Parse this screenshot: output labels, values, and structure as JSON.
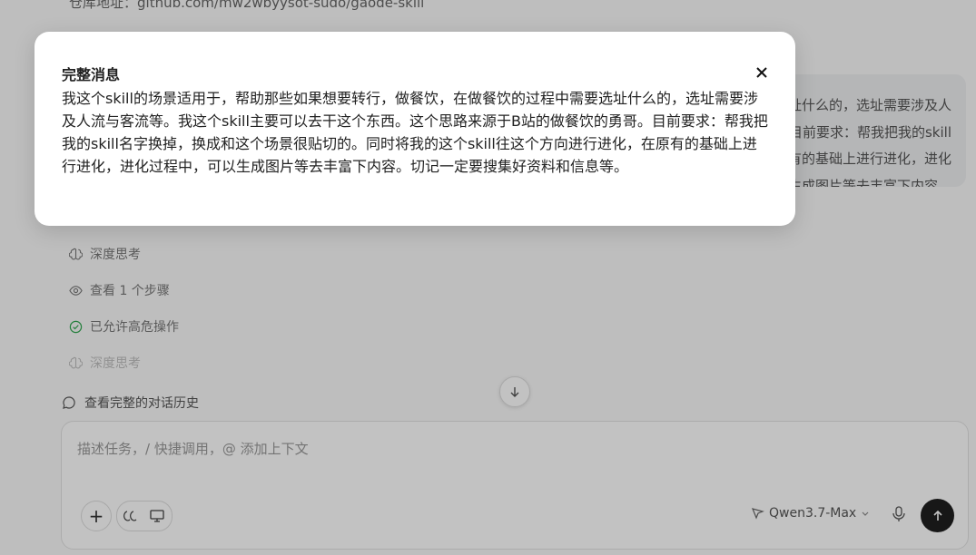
{
  "background": {
    "repo_line": "仓库地址：github.com/mw2wbyysot-sudo/gaode-skill",
    "user_message": "我这个skill的场景适用于，帮助那些如果想要转行，做餐饮，在做餐饮的过程中需要选址什么的，选址需要涉及人流与客流等。我这个skill主要可以去干这个东西。这个思路来源于B站的做餐饮的勇哥。目前要求：帮我把我的skill名字换掉，换成和这个场景很贴切的。同时将我的这个skill往这个方向进行进化，在原有的基础上进行进化，进化过程中，可以生成图片等去丰富下内容。",
    "steps": [
      {
        "label": "深度思考",
        "icon": "brain-icon"
      },
      {
        "label": "查看 1 个步骤",
        "icon": "eye-icon"
      },
      {
        "label": "已允许高危操作",
        "icon": "check-circle-icon"
      },
      {
        "label": "深度思考",
        "icon": "brain-icon"
      }
    ],
    "history_link": "查看完整的对话历史",
    "composer": {
      "placeholder": "描述任务，/ 快捷调用，@ 添加上下文",
      "model": "Qwen3.7-Max"
    }
  },
  "modal": {
    "title": "完整消息",
    "body": "我这个skill的场景适用于，帮助那些如果想要转行，做餐饮，在做餐饮的过程中需要选址什么的，选址需要涉及人流与客流等。我这个skill主要可以去干这个东西。这个思路来源于B站的做餐饮的勇哥。目前要求：帮我把我的skill名字换掉，换成和这个场景很贴切的。同时将我的这个skill往这个方向进行进化，在原有的基础上进行进化，进化过程中，可以生成图片等去丰富下内容。切记一定要搜集好资料和信息等。"
  },
  "colors": {
    "overlay": "#00000040",
    "send_button": "#1f1f1f",
    "check_green": "#2fa84f"
  }
}
